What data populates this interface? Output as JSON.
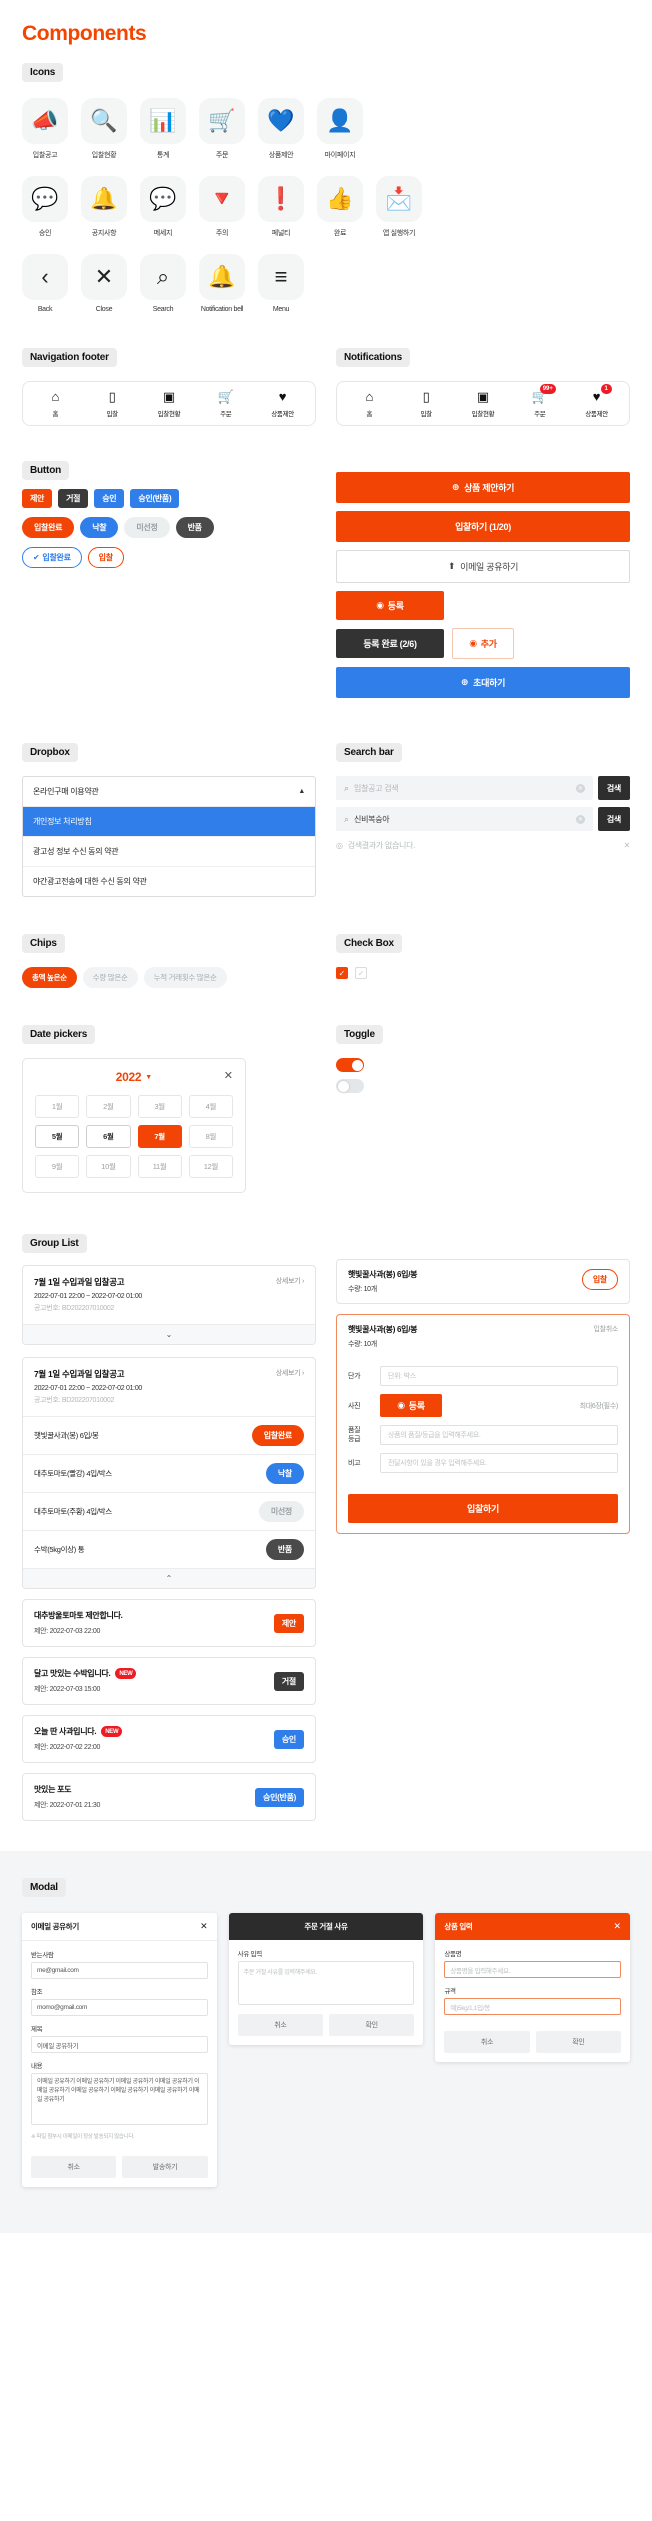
{
  "page": {
    "title": "Components"
  },
  "sections": {
    "icons": "Icons",
    "nav_footer": "Navigation footer",
    "notifications": "Notifications",
    "button": "Button",
    "dropbox": "Dropbox",
    "search_bar": "Search bar",
    "chips": "Chips",
    "check_box": "Check Box",
    "date_pickers": "Date pickers",
    "toggle": "Toggle",
    "group_list": "Group List",
    "modal": "Modal"
  },
  "icons": {
    "row1": [
      {
        "name": "megaphone-icon",
        "glyph": "📣",
        "label": "입찰공고"
      },
      {
        "name": "document-search-icon",
        "glyph": "🔍",
        "label": "입찰현황"
      },
      {
        "name": "bar-chart-icon",
        "glyph": "📊",
        "label": "통계"
      },
      {
        "name": "shopping-cart-icon",
        "glyph": "🛒",
        "label": "주문"
      },
      {
        "name": "product-heart-icon",
        "glyph": "💙",
        "label": "상품제안"
      },
      {
        "name": "user-profile-icon",
        "glyph": "👤",
        "label": "마이페이지"
      }
    ],
    "row2": [
      {
        "name": "approval-heart-icon",
        "glyph": "💬",
        "label": "승인"
      },
      {
        "name": "announcement-bell-icon",
        "glyph": "🔔",
        "label": "공지사항"
      },
      {
        "name": "message-icon",
        "glyph": "💬",
        "label": "메세지"
      },
      {
        "name": "warning-diamond-icon",
        "glyph": "🔻",
        "label": "주의"
      },
      {
        "name": "penalty-icon",
        "glyph": "❗",
        "label": "페널티"
      },
      {
        "name": "thumbs-up-icon",
        "glyph": "👍",
        "label": "완료"
      },
      {
        "name": "app-launch-mail-icon",
        "glyph": "📩",
        "label": "앱 실행하기"
      }
    ],
    "row3": [
      {
        "name": "back-chevron-icon",
        "glyph": "‹",
        "label": "Back"
      },
      {
        "name": "close-icon",
        "glyph": "✕",
        "label": "Close"
      },
      {
        "name": "search-icon",
        "glyph": "⌕",
        "label": "Search"
      },
      {
        "name": "notification-bell-icon",
        "glyph": "🔔",
        "label": "Notification bell"
      },
      {
        "name": "menu-icon",
        "glyph": "≡",
        "label": "Menu"
      }
    ]
  },
  "nav_footer": {
    "items": [
      {
        "icon": "home-icon",
        "glyph": "⌂",
        "label": "홈",
        "badge": ""
      },
      {
        "icon": "bid-icon",
        "glyph": "▯",
        "label": "입찰",
        "badge": ""
      },
      {
        "icon": "bid-status-icon",
        "glyph": "▣",
        "label": "입찰현황",
        "badge": ""
      },
      {
        "icon": "order-basket-icon",
        "glyph": "🛒",
        "label": "주문",
        "badge": ""
      },
      {
        "icon": "product-proposal-heart-icon",
        "glyph": "♥",
        "label": "상품제안",
        "badge": ""
      }
    ]
  },
  "notifications": {
    "items": [
      {
        "icon": "home-icon",
        "glyph": "⌂",
        "label": "홈",
        "badge": ""
      },
      {
        "icon": "bid-icon",
        "glyph": "▯",
        "label": "입찰",
        "badge": ""
      },
      {
        "icon": "bid-status-icon",
        "glyph": "▣",
        "label": "입찰현황",
        "badge": ""
      },
      {
        "icon": "order-basket-icon",
        "glyph": "🛒",
        "label": "주문",
        "badge": "99+"
      },
      {
        "icon": "product-proposal-heart-icon",
        "glyph": "♥",
        "label": "상품제안",
        "badge": "1"
      }
    ]
  },
  "buttons": {
    "tags": [
      {
        "label": "제안",
        "style": "orange"
      },
      {
        "label": "거절",
        "style": "dark"
      },
      {
        "label": "승인",
        "style": "blue"
      },
      {
        "label": "승인(반품)",
        "style": "blue"
      }
    ],
    "pills": [
      {
        "label": "입찰완료",
        "style": "orange"
      },
      {
        "label": "낙찰",
        "style": "blue"
      },
      {
        "label": "미선정",
        "style": "grey"
      },
      {
        "label": "반품",
        "style": "dark"
      }
    ],
    "outline_pills": [
      {
        "label": "입찰완료",
        "style": "blue",
        "icon": "check-circle-icon"
      },
      {
        "label": "입찰",
        "style": "orange",
        "icon": ""
      }
    ],
    "wide": [
      {
        "label": "상품 제안하기",
        "style": "orange",
        "icon": "plus-circle-icon"
      },
      {
        "label": "입찰하기 (1/20)",
        "style": "orange",
        "icon": ""
      },
      {
        "label": "이메일 공유하기",
        "style": "ghost",
        "icon": "share-icon"
      }
    ],
    "register": {
      "label": "등록",
      "icon": "camera-icon"
    },
    "register_done": {
      "label": "등록 완료 (2/6)"
    },
    "add": {
      "label": "추가",
      "icon": "camera-icon"
    },
    "invite": {
      "label": "초대하기",
      "icon": "plus-circle-icon"
    }
  },
  "dropbox": {
    "selected": "온라인구매 이용약관",
    "options": [
      {
        "label": "개인정보 처리방침",
        "selected": true
      },
      {
        "label": "광고성 정보 수신 동의 약관",
        "selected": false
      },
      {
        "label": "야간광고전송에 대한 수신 동의 약관",
        "selected": false
      }
    ]
  },
  "search_bar": {
    "placeholder": "입찰공고 검색",
    "value": "신비복숭아",
    "button_label": "검색",
    "no_result": "검색결과가 없습니다."
  },
  "chips": [
    {
      "label": "총액 높은순",
      "active": true
    },
    {
      "label": "수량 많은순",
      "active": false
    },
    {
      "label": "누적 거래횟수 많은순",
      "active": false
    }
  ],
  "checkbox": [
    {
      "name": "checked",
      "checked": true
    },
    {
      "name": "unchecked",
      "checked": false
    }
  ],
  "date_picker": {
    "year": "2022",
    "months": [
      {
        "label": "1월",
        "state": "disabled"
      },
      {
        "label": "2월",
        "state": "disabled"
      },
      {
        "label": "3월",
        "state": "disabled"
      },
      {
        "label": "4월",
        "state": "disabled"
      },
      {
        "label": "5월",
        "state": "available"
      },
      {
        "label": "6월",
        "state": "available"
      },
      {
        "label": "7월",
        "state": "selected"
      },
      {
        "label": "8월",
        "state": "disabled"
      },
      {
        "label": "9월",
        "state": "disabled"
      },
      {
        "label": "10월",
        "state": "disabled"
      },
      {
        "label": "11월",
        "state": "disabled"
      },
      {
        "label": "12월",
        "state": "disabled"
      }
    ]
  },
  "toggle": [
    {
      "name": "toggle-on",
      "on": true
    },
    {
      "name": "toggle-off",
      "on": false
    }
  ],
  "group_list": {
    "card1": {
      "title": "7월 1일 수입과일 입찰공고",
      "more": "상세보기 ›",
      "date": "2022-07-01 22:00 ~ 2022-07-02 01:00",
      "number": "공고번호: BD202207010002",
      "expand_icon": "chevron-down-icon"
    },
    "card2": {
      "title": "7월 1일 수입과일 입찰공고",
      "more": "상세보기 ›",
      "date": "2022-07-01 22:00 ~ 2022-07-02 01:00",
      "number": "공고번호: BD202207010002",
      "rows": [
        {
          "label": "햇빛꿀사과(봉) 6입/봉",
          "status": "입찰완료",
          "style": "orange"
        },
        {
          "label": "대추토마토(빨강) 4입/박스",
          "status": "낙찰",
          "style": "blue"
        },
        {
          "label": "대추토마토(주황) 4입/박스",
          "status": "미선정",
          "style": "grey"
        },
        {
          "label": "수박(5kg이상) 통",
          "status": "반품",
          "style": "dark"
        }
      ],
      "collapse_icon": "chevron-up-icon"
    },
    "notices": [
      {
        "title": "대추방울토마토 제안합니다.",
        "new": false,
        "sub": "제안: 2022-07-03 22:00",
        "action": "제안",
        "style": "orange"
      },
      {
        "title": "달고 맛있는 수박입니다.",
        "new": true,
        "new_label": "NEW",
        "sub": "제안: 2022-07-03 15:00",
        "action": "거절",
        "style": "dark"
      },
      {
        "title": "오늘 딴 사과입니다.",
        "new": true,
        "new_label": "NEW",
        "sub": "제안: 2022-07-02 22:00",
        "action": "승인",
        "style": "blue"
      },
      {
        "title": "맛있는 포도",
        "new": false,
        "sub": "제안: 2022-07-01 21:30",
        "action": "승인(반품)",
        "style": "blue"
      }
    ]
  },
  "bid_form": {
    "header": {
      "title": "햇빛꿀사과(봉) 6입/봉",
      "sub": "수량: 10개",
      "action": "입찰"
    },
    "card": {
      "title": "햇빛꿀사과(봉) 6입/봉",
      "sub": "수량: 10개",
      "right": "입찰취소",
      "fields": [
        {
          "label": "단가",
          "placeholder": "단위: 박스",
          "right": ""
        },
        {
          "label": "사진",
          "button": "등록",
          "right": "최대6장(필수)",
          "type": "button"
        },
        {
          "label": "품질\n등급",
          "placeholder": "상품의 품질/등급을 입력해주세요.",
          "right": ""
        },
        {
          "label": "비고",
          "placeholder": "전달사항이 있을 경우 입력해주세요.",
          "right": ""
        }
      ],
      "submit": "입찰하기"
    }
  },
  "modals": {
    "email": {
      "title": "이메일 공유하기",
      "close_icon": "close-icon",
      "fields": [
        {
          "label": "받는사람",
          "value": "me@gmail.com",
          "type": "text"
        },
        {
          "label": "참조",
          "value": "momo@gmail.com",
          "type": "text"
        },
        {
          "label": "제목",
          "value": "이메일 공유하기",
          "type": "text"
        },
        {
          "label": "내용",
          "value": "이메일 공유하기 이메일 공유하기 이메일 공유하기 이메일 공유하기 이메일 공유하기 이메일 공유하기 이메일 공유하기 이메일 공유하기 이메일 공유하기",
          "type": "textarea"
        }
      ],
      "note": "※ 파일 첨부시 이메일이 정상 발송되지 않습니다.",
      "buttons": [
        {
          "label": "취소",
          "style": "grey"
        },
        {
          "label": "발송하기",
          "style": "orange"
        }
      ]
    },
    "order": {
      "title": "주문 거절 사유",
      "preview_placeholder": "주문 거절 사유를 입력해주세요.",
      "buttons": [
        {
          "label": "취소",
          "style": "grey"
        },
        {
          "label": "확인",
          "style": "grey"
        }
      ]
    },
    "product": {
      "title": "상품 입력",
      "close_icon": "close-icon",
      "fields": [
        {
          "label": "상품명",
          "placeholder": "상품명을 입력해주세요."
        },
        {
          "label": "규격",
          "placeholder": "예)5kg/1,1입/봉"
        }
      ],
      "buttons": [
        {
          "label": "취소",
          "style": "grey"
        },
        {
          "label": "확인",
          "style": "grey"
        }
      ]
    }
  }
}
